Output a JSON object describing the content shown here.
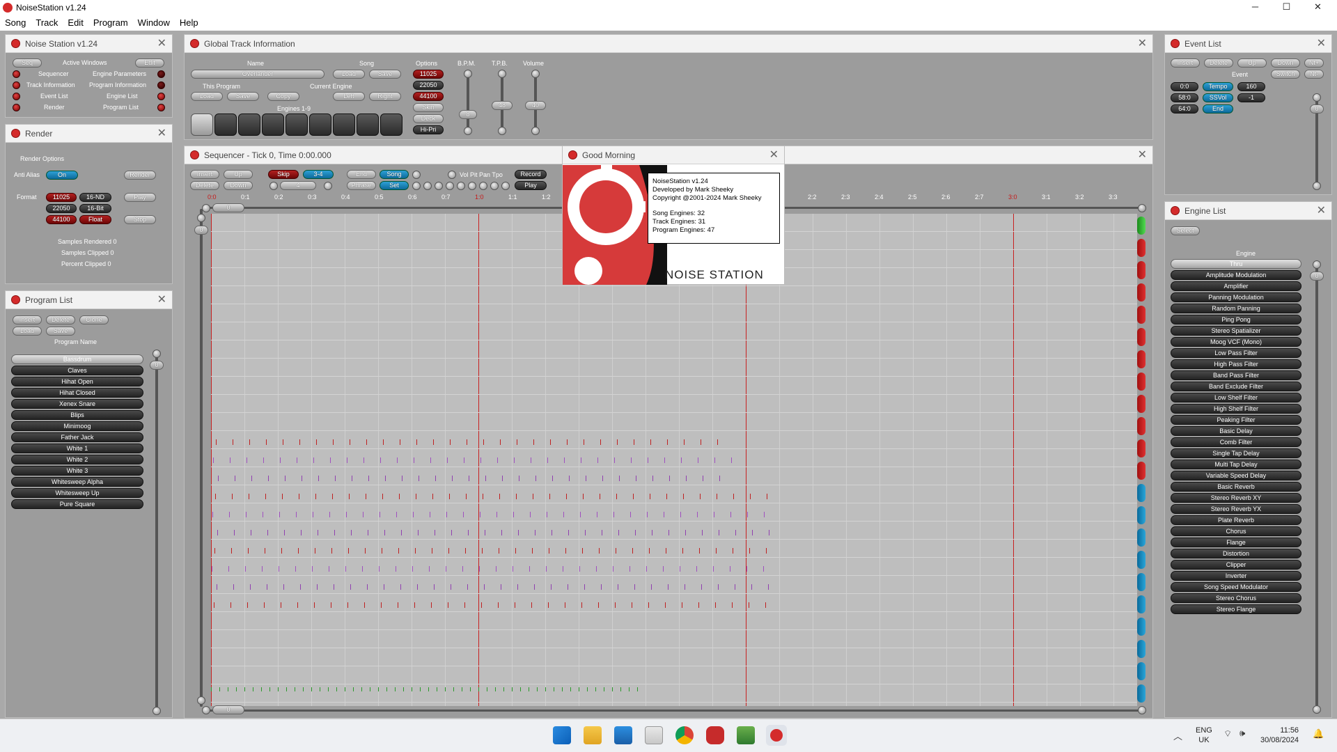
{
  "app": {
    "title": "NoiseStation v1.24"
  },
  "menu": [
    "Song",
    "Track",
    "Edit",
    "Program",
    "Window",
    "Help"
  ],
  "window_controls": {
    "minimize": "─",
    "maximize": "☐",
    "close": "✕"
  },
  "ns_panel": {
    "title": "Noise Station v1.24",
    "seq": "Seq",
    "active_windows": "Active Windows",
    "edit": "Edit",
    "left_items": [
      "Sequencer",
      "Track Information",
      "Event List",
      "Render"
    ],
    "right_items": [
      "Engine Parameters",
      "Program Information",
      "Engine List",
      "Program List"
    ]
  },
  "render_panel": {
    "title": "Render",
    "options": "Render Options",
    "anti_alias": "Anti Alias",
    "on": "On",
    "render": "Render",
    "format": "Format",
    "rates": [
      "11025",
      "22050",
      "44100"
    ],
    "bits": [
      "16-ND",
      "16-Bit",
      "Float"
    ],
    "play": "Play",
    "stop": "Stop",
    "stats": [
      "Samples Rendered 0",
      "Samples Clipped 0",
      "Percent Clipped 0"
    ]
  },
  "program_panel": {
    "title": "Program List",
    "insert": "Insert",
    "delete": "Delete",
    "clone": "Clone",
    "load": "Load",
    "save": "Save",
    "header": "Program Name",
    "slider": "0",
    "items": [
      "Bassdrum",
      "Claves",
      "Hihat Open",
      "Hihat Closed",
      "Xenex Snare",
      "Blips",
      "Minimoog",
      "Father Jack",
      "White 1",
      "White 2",
      "White 3",
      "Whitesweep Alpha",
      "Whitesweep Up",
      "Pure Square"
    ]
  },
  "gti_panel": {
    "title": "Global Track Information",
    "name_h": "Name",
    "song_h": "Song",
    "options_h": "Options",
    "bpm_h": "B.P.M.",
    "tpb_h": "T.P.B.",
    "volume_h": "Volume",
    "name_val": "Overlander",
    "load": "Load",
    "save": "Save",
    "this_program": "This Program",
    "current_engine": "Current Engine",
    "copy": "Copy",
    "left": "Left",
    "right": "Right",
    "engines": "Engines 1-9",
    "opt_rates": [
      "11025",
      "22050",
      "44100"
    ],
    "skin": "Skin",
    "deck": "Deck",
    "hipri": "Hi-Pri",
    "bpm": "8",
    "tpb": "48",
    "volume": "40"
  },
  "seq_panel": {
    "title": "Sequencer - Tick 0, Time 0:00.000",
    "insert": "Insert",
    "up": "Up",
    "delete": "Delete",
    "down": "Down",
    "skip": "Skip",
    "sig": "3-4",
    "qval": "4",
    "end": "End",
    "song": "Song",
    "phrase": "Phrase",
    "set": "Set",
    "vpp": "Vol Pit Pan Tpo",
    "record": "Record",
    "play": "Play",
    "top_slider": "0",
    "left_slider": "0",
    "bottom_slider": "0",
    "ticks_left": [
      "0:0",
      "0:1",
      "0:2",
      "0:3",
      "0:4",
      "0:5",
      "0:6",
      "0:7",
      "1:0",
      "1:1",
      "1:2"
    ],
    "ticks_right": [
      "2:2",
      "2:3",
      "2:4",
      "2:5",
      "2:6",
      "2:7",
      "3:0",
      "3:1",
      "3:2",
      "3:3"
    ]
  },
  "about": {
    "title": "Good Morning",
    "lines": [
      "NoiseStation v1.24",
      "Developed by Mark Sheeky",
      "Copyright @2001-2024 Mark Sheeky",
      "Song Engines: 32",
      "Track Engines: 31",
      "Program Engines: 47"
    ],
    "logo": "NOISE STATION"
  },
  "event_panel": {
    "title": "Event List",
    "insert": "Insert",
    "delete": "Delete",
    "up": "Up",
    "down": "Down",
    "ntplus": "Nt+",
    "ntminus": "Nt-",
    "event_h": "Event",
    "switch": "Switch",
    "slider": "0",
    "rows": [
      {
        "t": "0:0",
        "e": "Tempo",
        "v": "160"
      },
      {
        "t": "58:0",
        "e": "SSVol",
        "v": "-1"
      },
      {
        "t": "64:0",
        "e": "End",
        "v": ""
      }
    ]
  },
  "engine_panel": {
    "title": "Engine List",
    "select": "Select",
    "header": "Engine",
    "slider": "0",
    "items": [
      "Thru",
      "Amplitude Modulation",
      "Amplifier",
      "Panning Modulation",
      "Random Panning",
      "Ping Pong",
      "Stereo Spatializer",
      "Moog VCF (Mono)",
      "Low Pass Filter",
      "High Pass Filter",
      "Band Pass Filter",
      "Band Exclude Filter",
      "Low Shelf Filter",
      "High Shelf Filter",
      "Peaking Filter",
      "Basic Delay",
      "Comb Filter",
      "Single Tap Delay",
      "Multi Tap Delay",
      "Variable Speed Delay",
      "Basic Reverb",
      "Stereo Reverb XY",
      "Stereo Reverb YX",
      "Plate Reverb",
      "Chorus",
      "Flange",
      "Distortion",
      "Clipper",
      "Inverter",
      "Song Speed Modulator",
      "Stereo Chorus",
      "Stereo Flange"
    ]
  },
  "taskbar": {
    "lang1": "ENG",
    "lang2": "UK",
    "time": "11:56",
    "date": "30/08/2024"
  }
}
